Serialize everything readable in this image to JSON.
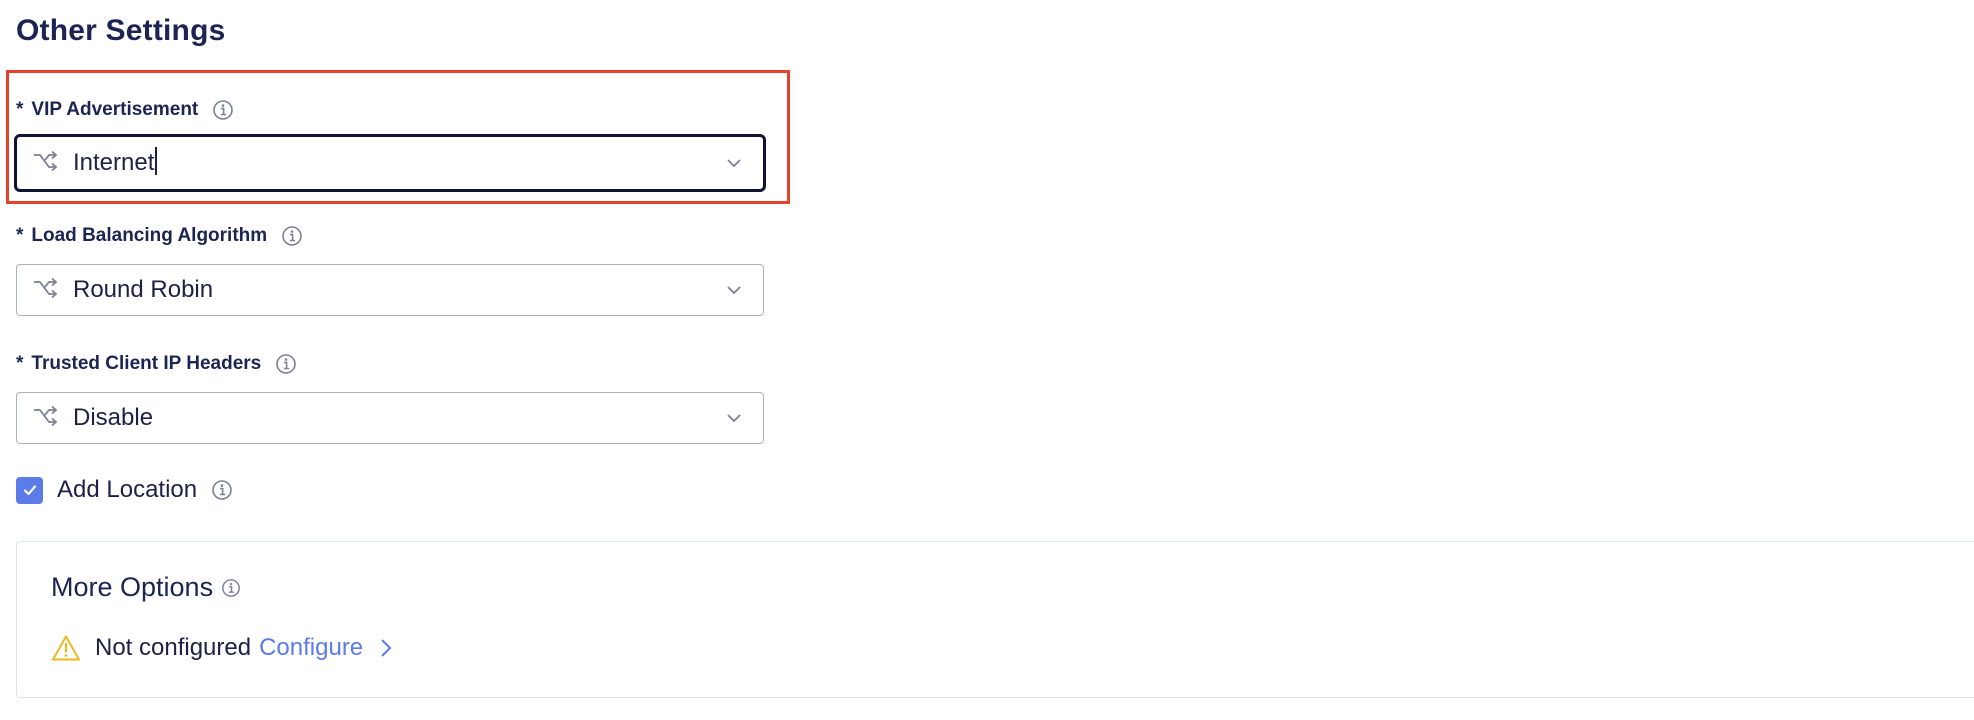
{
  "section": {
    "title": "Other Settings"
  },
  "fields": [
    {
      "required_mark": "*",
      "label": "VIP Advertisement",
      "value": "Internet"
    },
    {
      "required_mark": "*",
      "label": "Load Balancing Algorithm",
      "value": "Round Robin"
    },
    {
      "required_mark": "*",
      "label": "Trusted Client IP Headers",
      "value": "Disable"
    }
  ],
  "add_location": {
    "label": "Add Location",
    "checked": true
  },
  "more_options": {
    "title": "More Options",
    "status": "Not configured",
    "link": "Configure"
  },
  "colors": {
    "highlight": "#e5412b",
    "accent": "#5b7be8",
    "text": "#1d2147",
    "warning": "#e8b923"
  },
  "icons": {
    "field_icon": "route-icon",
    "dropdown_icon": "chevron-down-icon",
    "info_icon": "info-icon",
    "warning_icon": "warning-icon",
    "link_icon": "chevron-right-icon",
    "checkbox_icon": "check-icon"
  }
}
